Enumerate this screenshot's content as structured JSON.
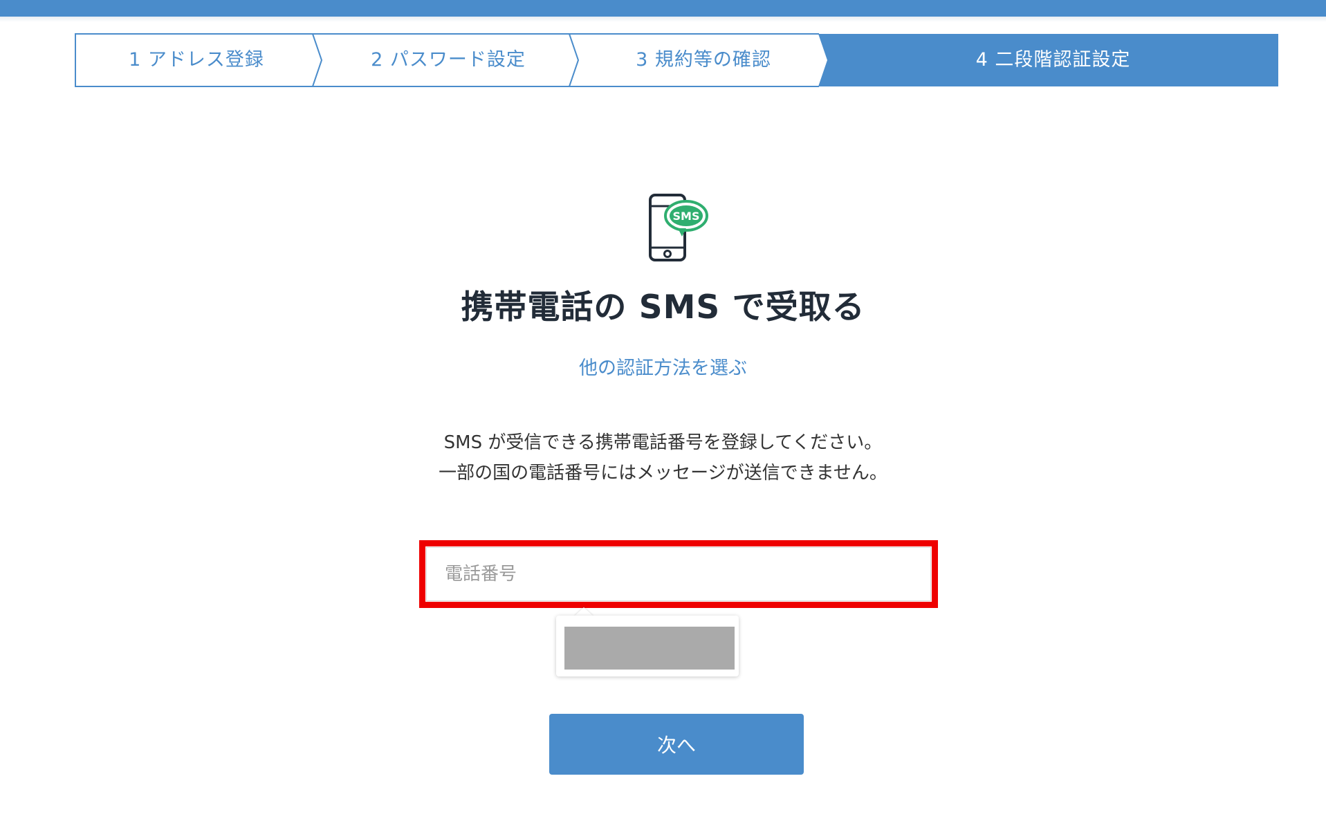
{
  "colors": {
    "accent": "#4a8ccb",
    "title_text": "#222c38",
    "body_text": "#333333",
    "highlight_outline": "#ee0000",
    "sms_badge": "#2fae6f"
  },
  "stepper": {
    "steps": [
      {
        "label": "1 アドレス登録",
        "active": false
      },
      {
        "label": "2 パスワード設定",
        "active": false
      },
      {
        "label": "3 規約等の確認",
        "active": false
      },
      {
        "label": "4 二段階認証設定",
        "active": true
      }
    ]
  },
  "main": {
    "icon": "phone-sms-icon",
    "icon_badge_text": "SMS",
    "title": "携帯電話の SMS で受取る",
    "alt_method_link": "他の認証方法を選ぶ",
    "description_line1": "SMS が受信できる携帯電話番号を登録してください。",
    "description_line2": "一部の国の電話番号にはメッセージが送信できません。",
    "phone_input": {
      "placeholder": "電話番号",
      "value": ""
    },
    "next_button_label": "次へ"
  }
}
